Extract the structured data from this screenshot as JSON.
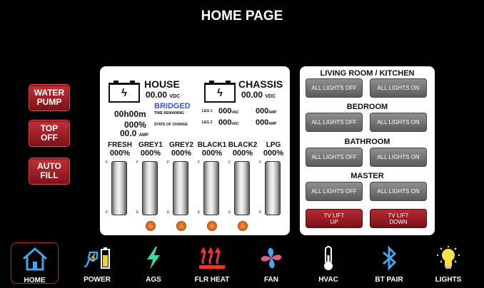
{
  "header": {
    "title": "HOME PAGE"
  },
  "side_buttons": [
    "WATER\nPUMP",
    "TOP\nOFF",
    "AUTO\nFILL"
  ],
  "house": {
    "label": "HOUSE",
    "voltage": "00.00",
    "voltage_unit": "VDC",
    "status": "BRIDGED",
    "time_remaining": "00h00m",
    "time_remaining_label": "TIME REMAINING",
    "state_of_charge": "000%",
    "state_of_charge_label": "STATE OF CHARGE",
    "amps": "00.0",
    "amps_unit": "AMP"
  },
  "chassis": {
    "label": "CHASSIS",
    "voltage": "00.00",
    "voltage_unit": "VDC",
    "leg1_label": "LEG 1",
    "leg1_vac": "000",
    "leg1_amp": "000",
    "leg2_label": "LEG 2",
    "leg2_vac": "000",
    "leg2_amp": "000",
    "vac_unit": "VAC",
    "amp_unit": "AMP"
  },
  "tanks": [
    {
      "name": "FRESH",
      "value": "000%"
    },
    {
      "name": "GREY1",
      "value": "000%"
    },
    {
      "name": "GREY2",
      "value": "000%"
    },
    {
      "name": "BLACK1",
      "value": "000%"
    },
    {
      "name": "BLACK2",
      "value": "000%"
    },
    {
      "name": "LPG",
      "value": "000%"
    }
  ],
  "tank_marks": {
    "full": "F",
    "empty": "E"
  },
  "rooms": [
    {
      "title": "LIVING ROOM / KITCHEN",
      "off": "ALL LIGHTS OFF",
      "on": "ALL LIGHTS ON"
    },
    {
      "title": "BEDROOM",
      "off": "ALL LIGHTS OFF",
      "on": "ALL LIGHTS ON"
    },
    {
      "title": "BATHROOM",
      "off": "ALL LIGHTS OFF",
      "on": "ALL LIGHTS ON"
    },
    {
      "title": "MASTER",
      "off": "ALL LIGHTS OFF",
      "on": "ALL LIGHTS ON"
    }
  ],
  "tv_lift": {
    "up": "TV LIFT\nUP",
    "down": "TV LIFT\nDOWN"
  },
  "nav": [
    {
      "label": "HOME",
      "icon": "home-icon"
    },
    {
      "label": "POWER",
      "icon": "power-icon"
    },
    {
      "label": "AGS",
      "icon": "lightning-icon"
    },
    {
      "label": "FLR HEAT",
      "icon": "floor-heat-icon"
    },
    {
      "label": "FAN",
      "icon": "fan-icon"
    },
    {
      "label": "HVAC",
      "icon": "thermometer-icon"
    },
    {
      "label": "BT PAIR",
      "icon": "bluetooth-icon"
    },
    {
      "label": "LIGHTS",
      "icon": "lightbulb-icon"
    }
  ],
  "colors": {
    "accent_red": "#b52a32",
    "gray_button": "#6e6e6e",
    "bridged_blue": "#3355cc",
    "ags_green": "#3fd99a"
  }
}
